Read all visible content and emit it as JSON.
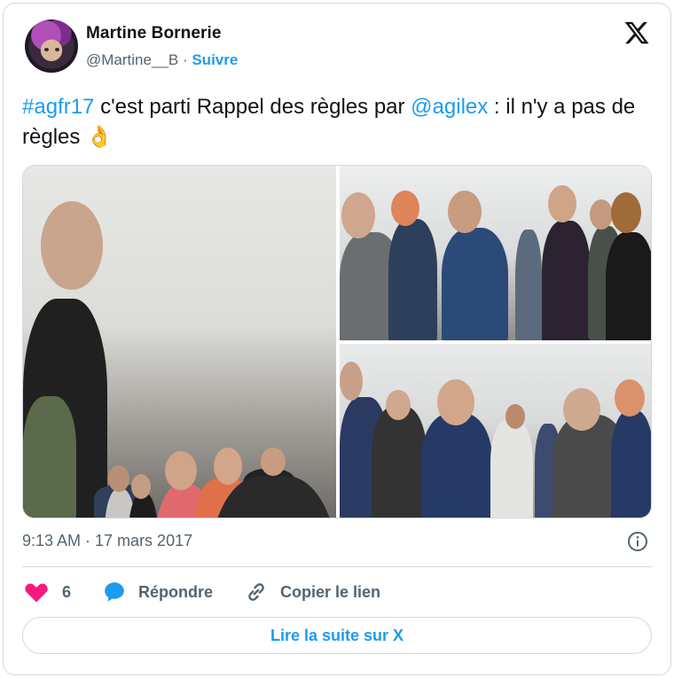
{
  "author": {
    "name": "Martine Bornerie",
    "handle": "@Martine__B",
    "separator": "·",
    "follow_label": "Suivre"
  },
  "tweet": {
    "hashtag": "#agfr17",
    "text_part1": " c'est parti Rappel des règles par ",
    "mention": "@agilex",
    "text_part2": " : il n'y a pas de règles ",
    "emoji": "👌"
  },
  "photos": [
    {
      "name": "group photo left"
    },
    {
      "name": "group photo top right"
    },
    {
      "name": "group photo bottom right"
    }
  ],
  "timestamp": "9:13 AM · 17 mars 2017",
  "actions": {
    "like_count": "6",
    "reply_label": "Répondre",
    "copy_label": "Copier le lien"
  },
  "read_more_label": "Lire la suite sur X",
  "colors": {
    "link": "#1d9bf0",
    "like": "#f91880",
    "secondary_text": "#536471",
    "border": "#cfd9de"
  },
  "icons": [
    "x-logo-icon",
    "info-icon",
    "heart-icon",
    "reply-bubble-icon",
    "link-icon"
  ]
}
